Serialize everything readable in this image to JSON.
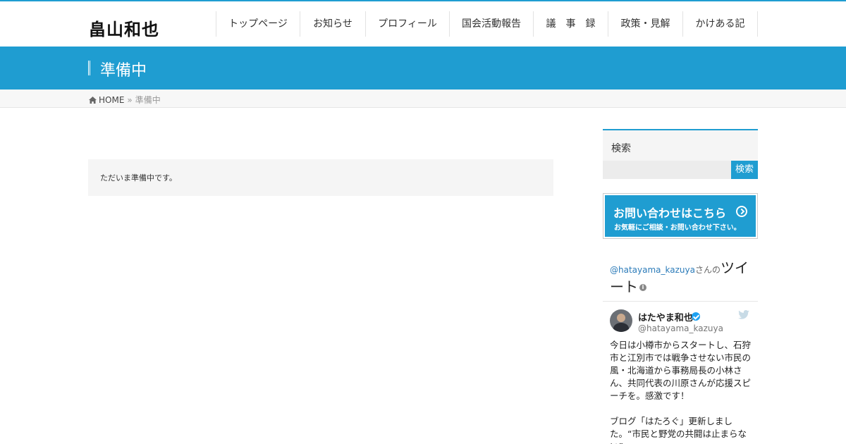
{
  "site": {
    "logo": "畠山和也"
  },
  "nav": [
    {
      "label": "トップページ"
    },
    {
      "label": "お知らせ"
    },
    {
      "label": "プロフィール"
    },
    {
      "label": "国会活動報告"
    },
    {
      "label": "議　事　録"
    },
    {
      "label": "政策・見解"
    },
    {
      "label": "かけある記"
    }
  ],
  "page": {
    "title": "準備中"
  },
  "breadcrumb": {
    "home": "HOME",
    "separator": "»",
    "current": "準備中"
  },
  "main": {
    "notice": "ただいま準備中です。"
  },
  "sidebar": {
    "search": {
      "title": "検索",
      "button": "検索",
      "placeholder": ""
    },
    "contact": {
      "line1": "お問い合わせはこちら",
      "line2": "お気軽にご相談・お問い合わせ下さい。"
    },
    "twitter": {
      "handle": "@hatayama_kazuya",
      "san": "さんの",
      "title": "ツイート",
      "name": "はたやま和也",
      "username": "@hatayama_kazuya",
      "tweet_p1": "今日は小樽市からスタートし、石狩市と江別市では戦争させない市民の風・北海道から事務局長の小林さん、共同代表の川原さんが応援スピーチを。感激です！",
      "tweet_p2": "ブログ「はたろぐ」更新しました。“市民と野党の共闘は止まらない”"
    }
  },
  "colors": {
    "accent": "#1f9dd1",
    "twitter": "#1da1f2"
  },
  "icons": [
    "home-icon",
    "arrow-circle-icon",
    "info-icon",
    "verified-icon",
    "twitter-bird-icon"
  ]
}
